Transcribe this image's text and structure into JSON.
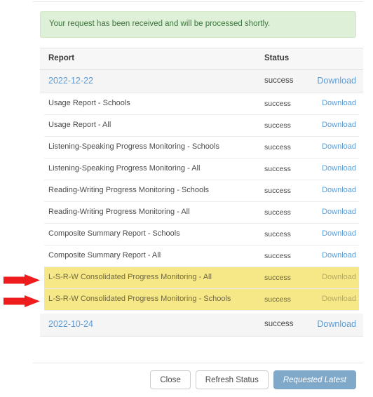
{
  "alert": {
    "message": "Your request has been received and will be processed shortly."
  },
  "table": {
    "columns": {
      "report": "Report",
      "status": "Status",
      "action": ""
    },
    "groups": [
      {
        "date": "2022-12-22",
        "status": "success",
        "download_label": "Download",
        "rows": [
          {
            "name": "Usage Report - Schools",
            "status": "success",
            "download_label": "Download",
            "highlighted": false
          },
          {
            "name": "Usage Report - All",
            "status": "success",
            "download_label": "Download",
            "highlighted": false
          },
          {
            "name": "Listening-Speaking Progress Monitoring - Schools",
            "status": "success",
            "download_label": "Download",
            "highlighted": false
          },
          {
            "name": "Listening-Speaking Progress Monitoring - All",
            "status": "success",
            "download_label": "Download",
            "highlighted": false
          },
          {
            "name": "Reading-Writing Progress Monitoring - Schools",
            "status": "success",
            "download_label": "Download",
            "highlighted": false
          },
          {
            "name": "Reading-Writing Progress Monitoring - All",
            "status": "success",
            "download_label": "Download",
            "highlighted": false
          },
          {
            "name": "Composite Summary Report - Schools",
            "status": "success",
            "download_label": "Download",
            "highlighted": false
          },
          {
            "name": "Composite Summary Report - All",
            "status": "success",
            "download_label": "Download",
            "highlighted": false
          },
          {
            "name": "L-S-R-W Consolidated Progress Monitoring - All",
            "status": "success",
            "download_label": "Download",
            "highlighted": true
          },
          {
            "name": "L-S-R-W Consolidated Progress Monitoring - Schools",
            "status": "success",
            "download_label": "Download",
            "highlighted": true
          }
        ]
      },
      {
        "date": "2022-10-24",
        "status": "success",
        "download_label": "Download",
        "rows": []
      }
    ]
  },
  "footer": {
    "close_label": "Close",
    "refresh_label": "Refresh Status",
    "requested_label": "Requested Latest"
  },
  "annotations": {
    "arrow_color": "#ee1c1c",
    "arrows": [
      {
        "name": "arrow-pointing-lsrw-all-row"
      },
      {
        "name": "arrow-pointing-lsrw-schools-row"
      }
    ]
  },
  "colors": {
    "alert_bg": "#dff0d8",
    "alert_text": "#3c763d",
    "link": "#5b9bd5",
    "highlight_row": "#f7e887",
    "primary_button": "#7fa8c9"
  }
}
